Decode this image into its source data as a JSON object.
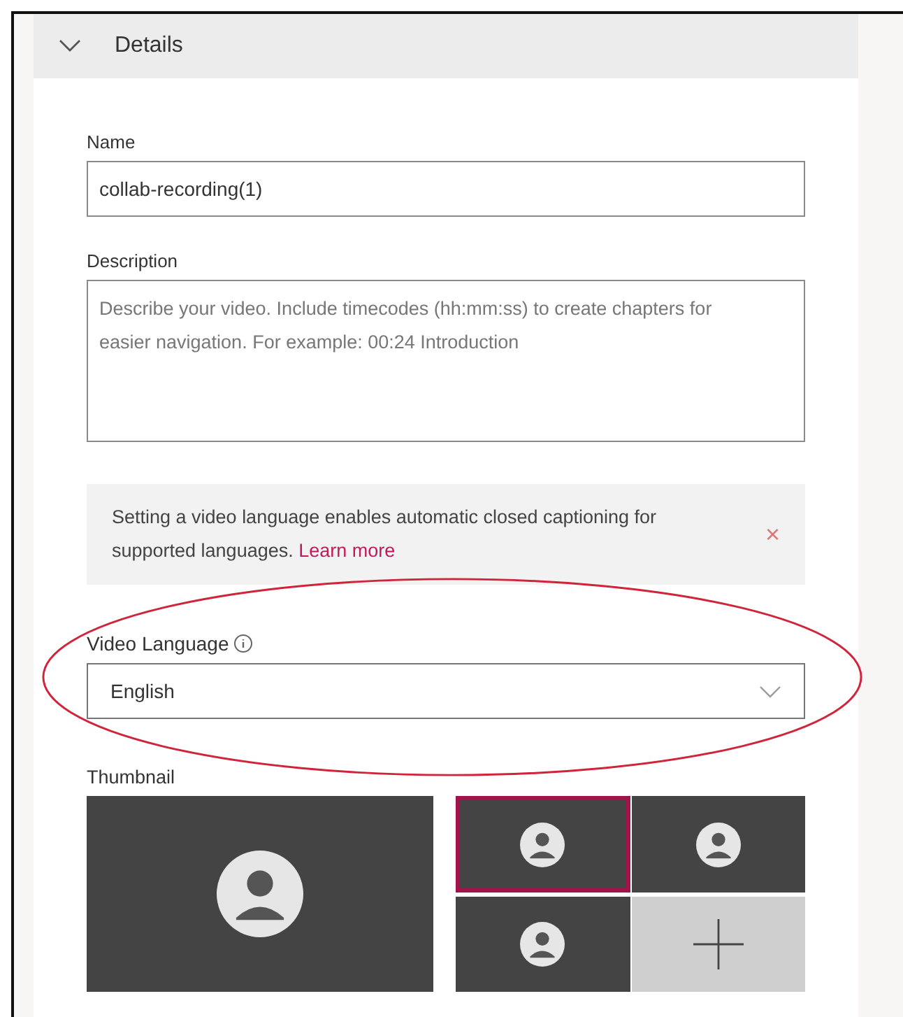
{
  "section": {
    "title": "Details",
    "expanded": true
  },
  "name_field": {
    "label": "Name",
    "value": "collab-recording(1)"
  },
  "description_field": {
    "label": "Description",
    "placeholder": "Describe your video. Include timecodes (hh:mm:ss) to create chapters for easier navigation. For example: 00:24 Introduction"
  },
  "notice": {
    "text": "Setting a video language enables automatic closed captioning for supported languages.",
    "link": "Learn more",
    "close": "×"
  },
  "language": {
    "label": "Video Language",
    "value": "English",
    "highlighted": true
  },
  "thumbnail": {
    "label": "Thumbnail",
    "items": [
      {
        "kind": "featured",
        "selected": false
      },
      {
        "kind": "person",
        "selected": true
      },
      {
        "kind": "person",
        "selected": false
      },
      {
        "kind": "person",
        "selected": false
      },
      {
        "kind": "add",
        "selected": false
      }
    ]
  }
}
